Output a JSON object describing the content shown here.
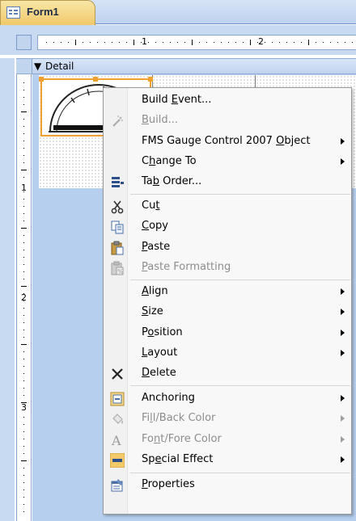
{
  "window": {
    "tab_title": "Form1",
    "section_label": "Detail"
  },
  "ruler": {
    "h_numbers": [
      "1",
      "2"
    ],
    "v_numbers": [
      "1",
      "2",
      "3"
    ]
  },
  "context_menu": {
    "items": [
      {
        "pre": "Build ",
        "u": "E",
        "post": "vent...",
        "enabled": true,
        "submenu": false,
        "icon": ""
      },
      {
        "pre": "",
        "u": "B",
        "post": "uild...",
        "enabled": false,
        "submenu": false,
        "icon": "wand-icon"
      },
      {
        "pre": "FMS Gauge Control 2007 ",
        "u": "O",
        "post": "bject",
        "enabled": true,
        "submenu": true,
        "icon": ""
      },
      {
        "pre": "C",
        "u": "h",
        "post": "ange To",
        "enabled": true,
        "submenu": true,
        "icon": ""
      },
      {
        "pre": "Ta",
        "u": "b",
        "post": " Order...",
        "enabled": true,
        "submenu": false,
        "icon": "tab-order-icon"
      },
      {
        "pre": "Cu",
        "u": "t",
        "post": "",
        "enabled": true,
        "submenu": false,
        "icon": "scissors-icon"
      },
      {
        "pre": "",
        "u": "C",
        "post": "opy",
        "enabled": true,
        "submenu": false,
        "icon": "copy-icon"
      },
      {
        "pre": "",
        "u": "P",
        "post": "aste",
        "enabled": true,
        "submenu": false,
        "icon": "paste-icon"
      },
      {
        "pre": "",
        "u": "P",
        "post": "aste Formatting",
        "enabled": false,
        "submenu": false,
        "icon": "paste-formatting-icon"
      },
      {
        "pre": "",
        "u": "A",
        "post": "lign",
        "enabled": true,
        "submenu": true,
        "icon": ""
      },
      {
        "pre": "",
        "u": "S",
        "post": "ize",
        "enabled": true,
        "submenu": true,
        "icon": ""
      },
      {
        "pre": "P",
        "u": "o",
        "post": "sition",
        "enabled": true,
        "submenu": true,
        "icon": ""
      },
      {
        "pre": "",
        "u": "L",
        "post": "ayout",
        "enabled": true,
        "submenu": true,
        "icon": ""
      },
      {
        "pre": "",
        "u": "D",
        "post": "elete",
        "enabled": true,
        "submenu": false,
        "icon": "delete-icon"
      },
      {
        "pre": "Anchoring",
        "u": "",
        "post": "",
        "enabled": true,
        "submenu": true,
        "icon": "anchoring-icon"
      },
      {
        "pre": "Fi",
        "u": "l",
        "post": "l/Back Color",
        "enabled": false,
        "submenu": true,
        "icon": "fill-bucket-icon"
      },
      {
        "pre": "Fo",
        "u": "n",
        "post": "t/Fore Color",
        "enabled": false,
        "submenu": true,
        "icon": "font-color-icon"
      },
      {
        "pre": "Sp",
        "u": "e",
        "post": "cial Effect",
        "enabled": true,
        "submenu": true,
        "icon": "special-effect-icon"
      },
      {
        "pre": "",
        "u": "P",
        "post": "roperties",
        "enabled": true,
        "submenu": false,
        "icon": "properties-icon"
      }
    ]
  },
  "colors": {
    "accent": "#f0a030",
    "canvas": "#b7cfee",
    "disabled_text": "#8d8d8d"
  }
}
